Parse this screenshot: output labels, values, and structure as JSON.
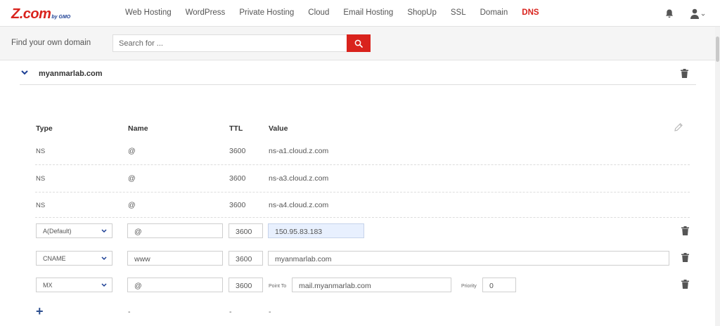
{
  "logo": {
    "brand": "Z.com",
    "suffix": "by GMO"
  },
  "nav": {
    "items": [
      {
        "label": "Web Hosting"
      },
      {
        "label": "WordPress"
      },
      {
        "label": "Private Hosting"
      },
      {
        "label": "Cloud"
      },
      {
        "label": "Email Hosting"
      },
      {
        "label": "ShopUp"
      },
      {
        "label": "SSL"
      },
      {
        "label": "Domain"
      },
      {
        "label": "DNS",
        "active": true
      }
    ],
    "icons": [
      "bell-icon",
      "user-icon",
      "chevron-down-icon"
    ]
  },
  "search": {
    "label": "Find your own domain",
    "placeholder": "Search for ...",
    "button_icon": "search-icon"
  },
  "domain": {
    "name": "myanmarlab.com"
  },
  "table": {
    "headers": {
      "type": "Type",
      "name": "Name",
      "ttl": "TTL",
      "value": "Value"
    },
    "static_rows": [
      {
        "type": "NS",
        "name": "@",
        "ttl": "3600",
        "value": "ns-a1.cloud.z.com"
      },
      {
        "type": "NS",
        "name": "@",
        "ttl": "3600",
        "value": "ns-a3.cloud.z.com"
      },
      {
        "type": "NS",
        "name": "@",
        "ttl": "3600",
        "value": "ns-a4.cloud.z.com"
      }
    ],
    "edit_rows": [
      {
        "type": "A(Default)",
        "name": "@",
        "ttl": "3600",
        "value": "150.95.83.183"
      },
      {
        "type": "CNAME",
        "name": "www",
        "ttl": "3600",
        "value": "myanmarlab.com"
      },
      {
        "type": "MX",
        "name": "@",
        "ttl": "3600",
        "point_to_label": "Point To",
        "value": "mail.myanmarlab.com",
        "priority_label": "Priority",
        "priority": "0"
      }
    ],
    "new_row": {
      "name": "-",
      "ttl": "-",
      "value": "-"
    }
  },
  "colors": {
    "accent": "#d9231d",
    "brand_blue": "#1c3f94",
    "plus": "#2d4f8f"
  }
}
